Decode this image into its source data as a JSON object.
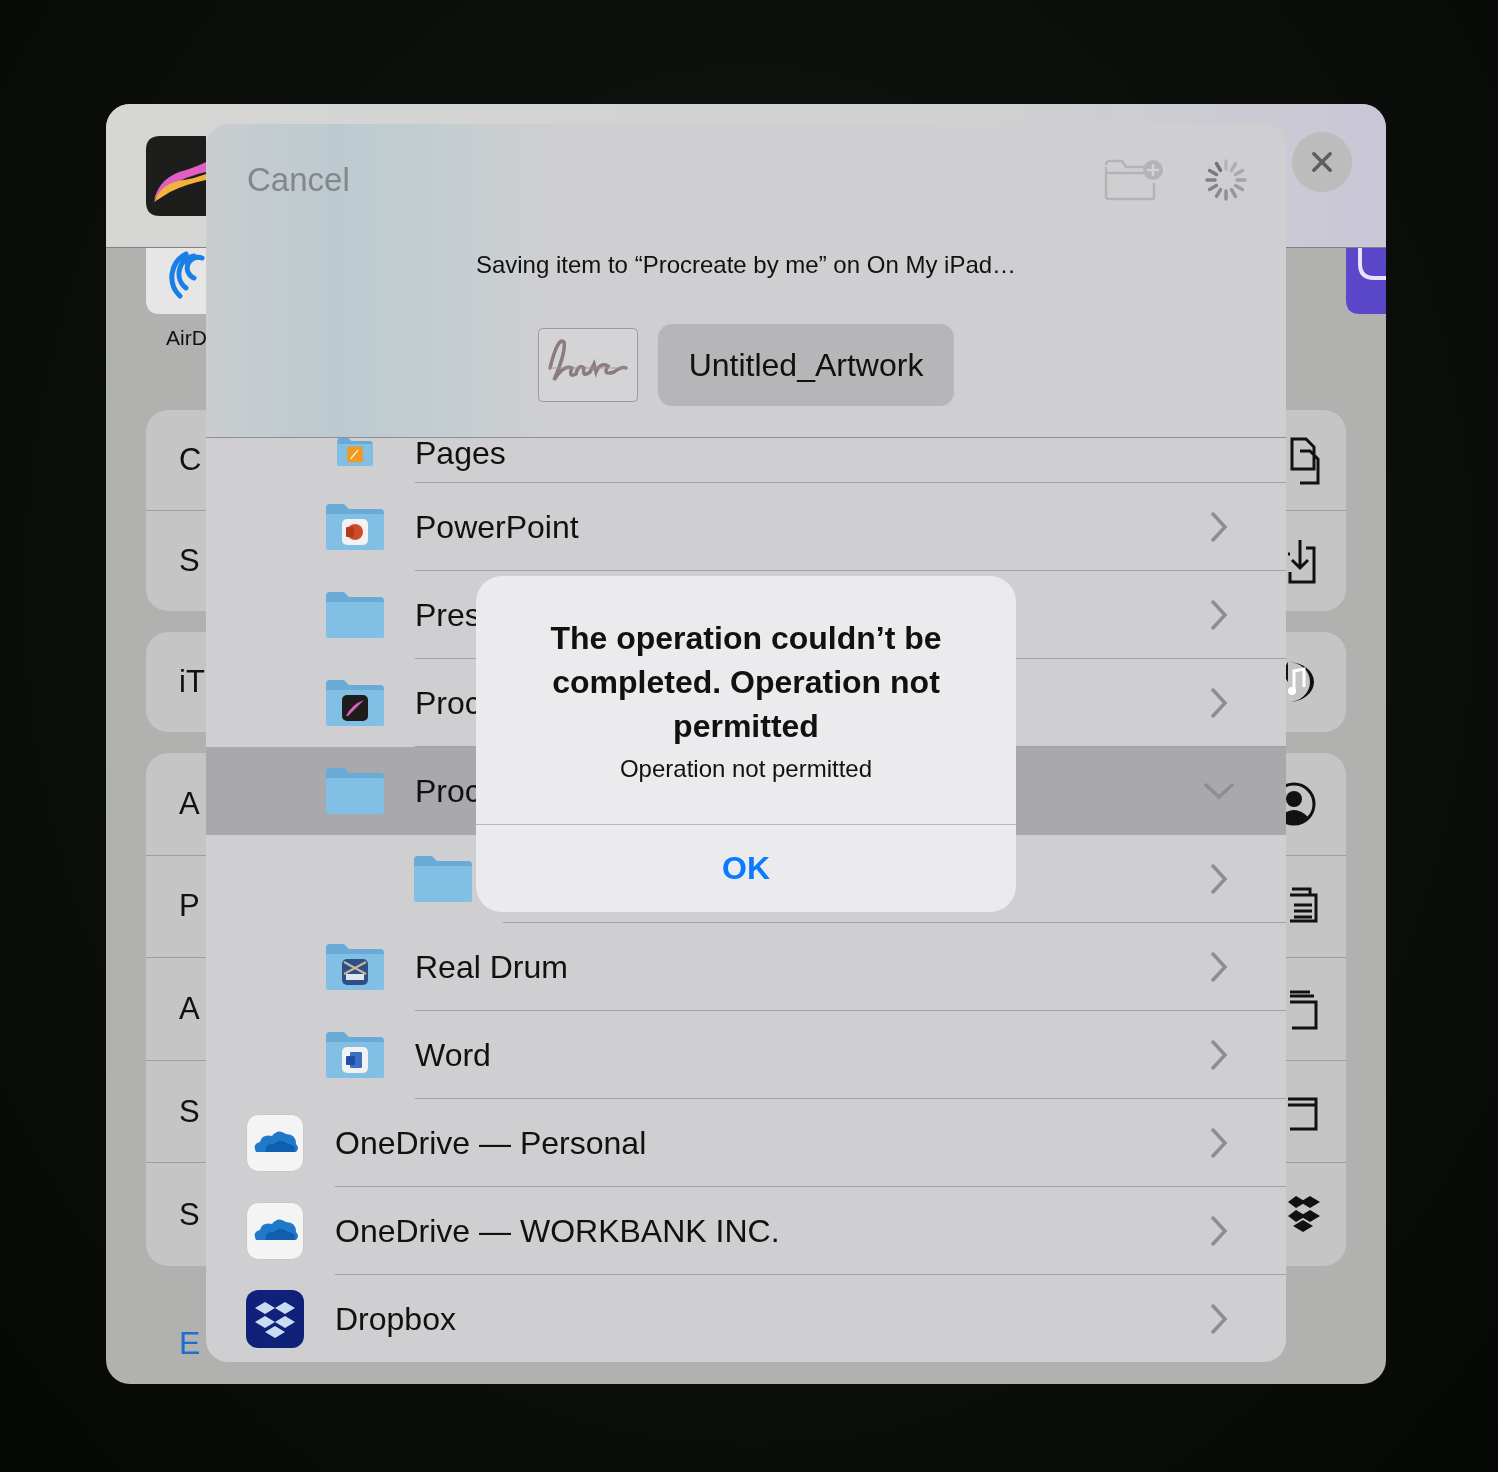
{
  "share_sheet": {
    "apps": [
      {
        "kind": "airdrop",
        "label": "AirD"
      },
      {
        "kind": "app"
      }
    ],
    "action_groups": [
      [
        {
          "label": "C",
          "kind": "copy"
        },
        {
          "label": "S",
          "kind": "save"
        }
      ],
      [
        {
          "label": "iT",
          "kind": "music"
        }
      ],
      [
        {
          "label": "A",
          "kind": "person"
        },
        {
          "label": "P",
          "kind": "print"
        },
        {
          "label": "A",
          "kind": "stack"
        },
        {
          "label": "S",
          "kind": "window"
        },
        {
          "label": "S",
          "kind": "dropbox"
        }
      ]
    ],
    "edit_link": "E"
  },
  "save_dialog": {
    "cancel": "Cancel",
    "status": "Saving item to “Procreate by me” on On My iPad…",
    "filename": "Untitled_Artwork",
    "locations": [
      {
        "kind": "pages",
        "label": "Pages",
        "selected": false
      },
      {
        "kind": "powerpoint",
        "label": "PowerPoint",
        "selected": false,
        "expanded": false
      },
      {
        "kind": "folder",
        "label": "Pres",
        "selected": false,
        "expanded": false
      },
      {
        "kind": "procreate",
        "label": "Proc",
        "selected": false,
        "expanded": false
      },
      {
        "kind": "folder",
        "label": "Proc",
        "selected": true,
        "expanded": true,
        "children": [
          {
            "kind": "folder",
            "selected": false,
            "expanded": false
          }
        ]
      },
      {
        "kind": "realdrum",
        "label": "Real Drum",
        "selected": false,
        "expanded": false
      },
      {
        "kind": "word",
        "label": "Word",
        "selected": false,
        "expanded": false
      },
      {
        "kind": "onedrive",
        "label": "OneDrive — Personal",
        "selected": false,
        "expanded": false
      },
      {
        "kind": "onedrive",
        "label": "OneDrive — WORKBANK INC.",
        "selected": false,
        "expanded": false
      },
      {
        "kind": "dropbox",
        "label": "Dropbox",
        "selected": false,
        "expanded": false
      }
    ]
  },
  "alert": {
    "title": "The operation couldn’t be completed. Operation not permitted",
    "message": "Operation not permitted",
    "button": "OK"
  }
}
